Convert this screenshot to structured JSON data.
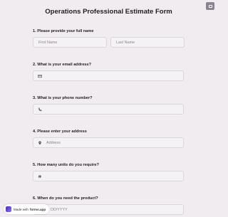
{
  "form": {
    "title": "Operations Professional Estimate Form"
  },
  "questions": [
    {
      "label": "1.  Please provide your full name",
      "fields": [
        {
          "placeholder": "First Name"
        },
        {
          "placeholder": "Last Name"
        }
      ]
    },
    {
      "label": "2.  What is your email address?",
      "icon": "email-icon"
    },
    {
      "label": "3.  What is your phone number?",
      "icon": "phone-icon"
    },
    {
      "label": "4.  Please enter your address",
      "icon": "location-pin-icon",
      "placeholder": "Address"
    },
    {
      "label": "5.  How many units do you require?",
      "icon": "hash-icon"
    },
    {
      "label": "6.  When do you need the product?",
      "placeholder": "DD/YYYY"
    }
  ],
  "badge": {
    "prefix": "Made with",
    "brand": "forms.app"
  }
}
